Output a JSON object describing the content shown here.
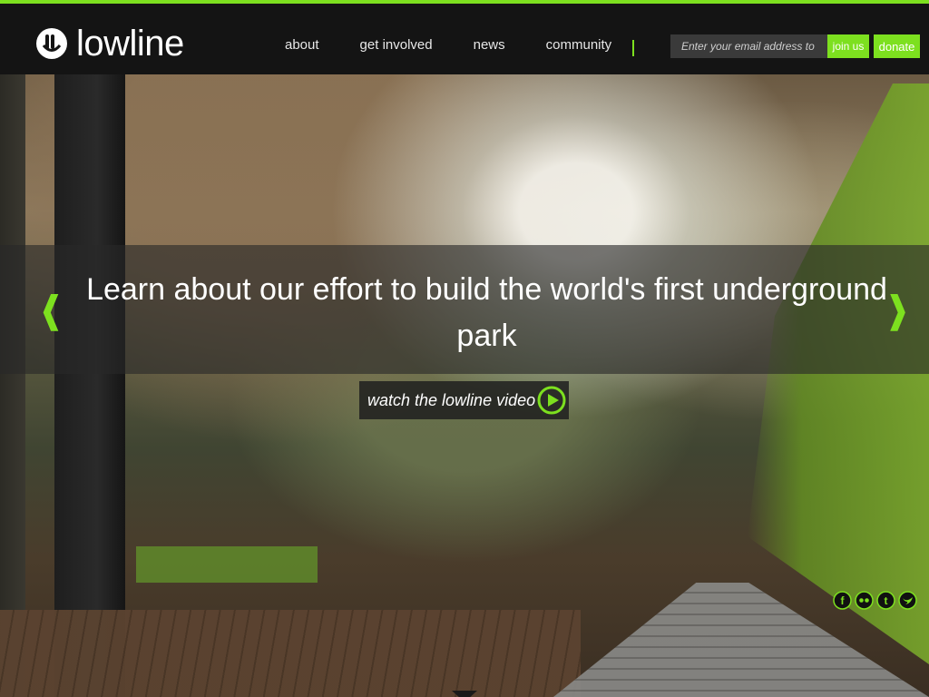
{
  "brand": {
    "name": "lowline",
    "accent": "#7de01f",
    "logo_icon": "lowline-logo-icon"
  },
  "nav": {
    "items": [
      {
        "label": "about"
      },
      {
        "label": "get involved"
      },
      {
        "label": "news"
      },
      {
        "label": "community"
      }
    ]
  },
  "signup": {
    "placeholder": "Enter your email address to",
    "join_label": "join us",
    "donate_label": "donate"
  },
  "hero": {
    "headline": "Learn about our effort to build the world's first underground park",
    "video_label": "watch the lowline video",
    "prev_arrow": "❰",
    "next_arrow": "❱",
    "icons": {
      "play": "play-circle-icon",
      "prev": "chevron-left-icon",
      "next": "chevron-right-icon"
    }
  },
  "social": {
    "items": [
      {
        "name": "facebook-icon",
        "glyph": "f"
      },
      {
        "name": "flickr-icon",
        "glyph": "••"
      },
      {
        "name": "tumblr-icon",
        "glyph": "t"
      },
      {
        "name": "twitter-icon",
        "glyph": "✔"
      }
    ]
  }
}
